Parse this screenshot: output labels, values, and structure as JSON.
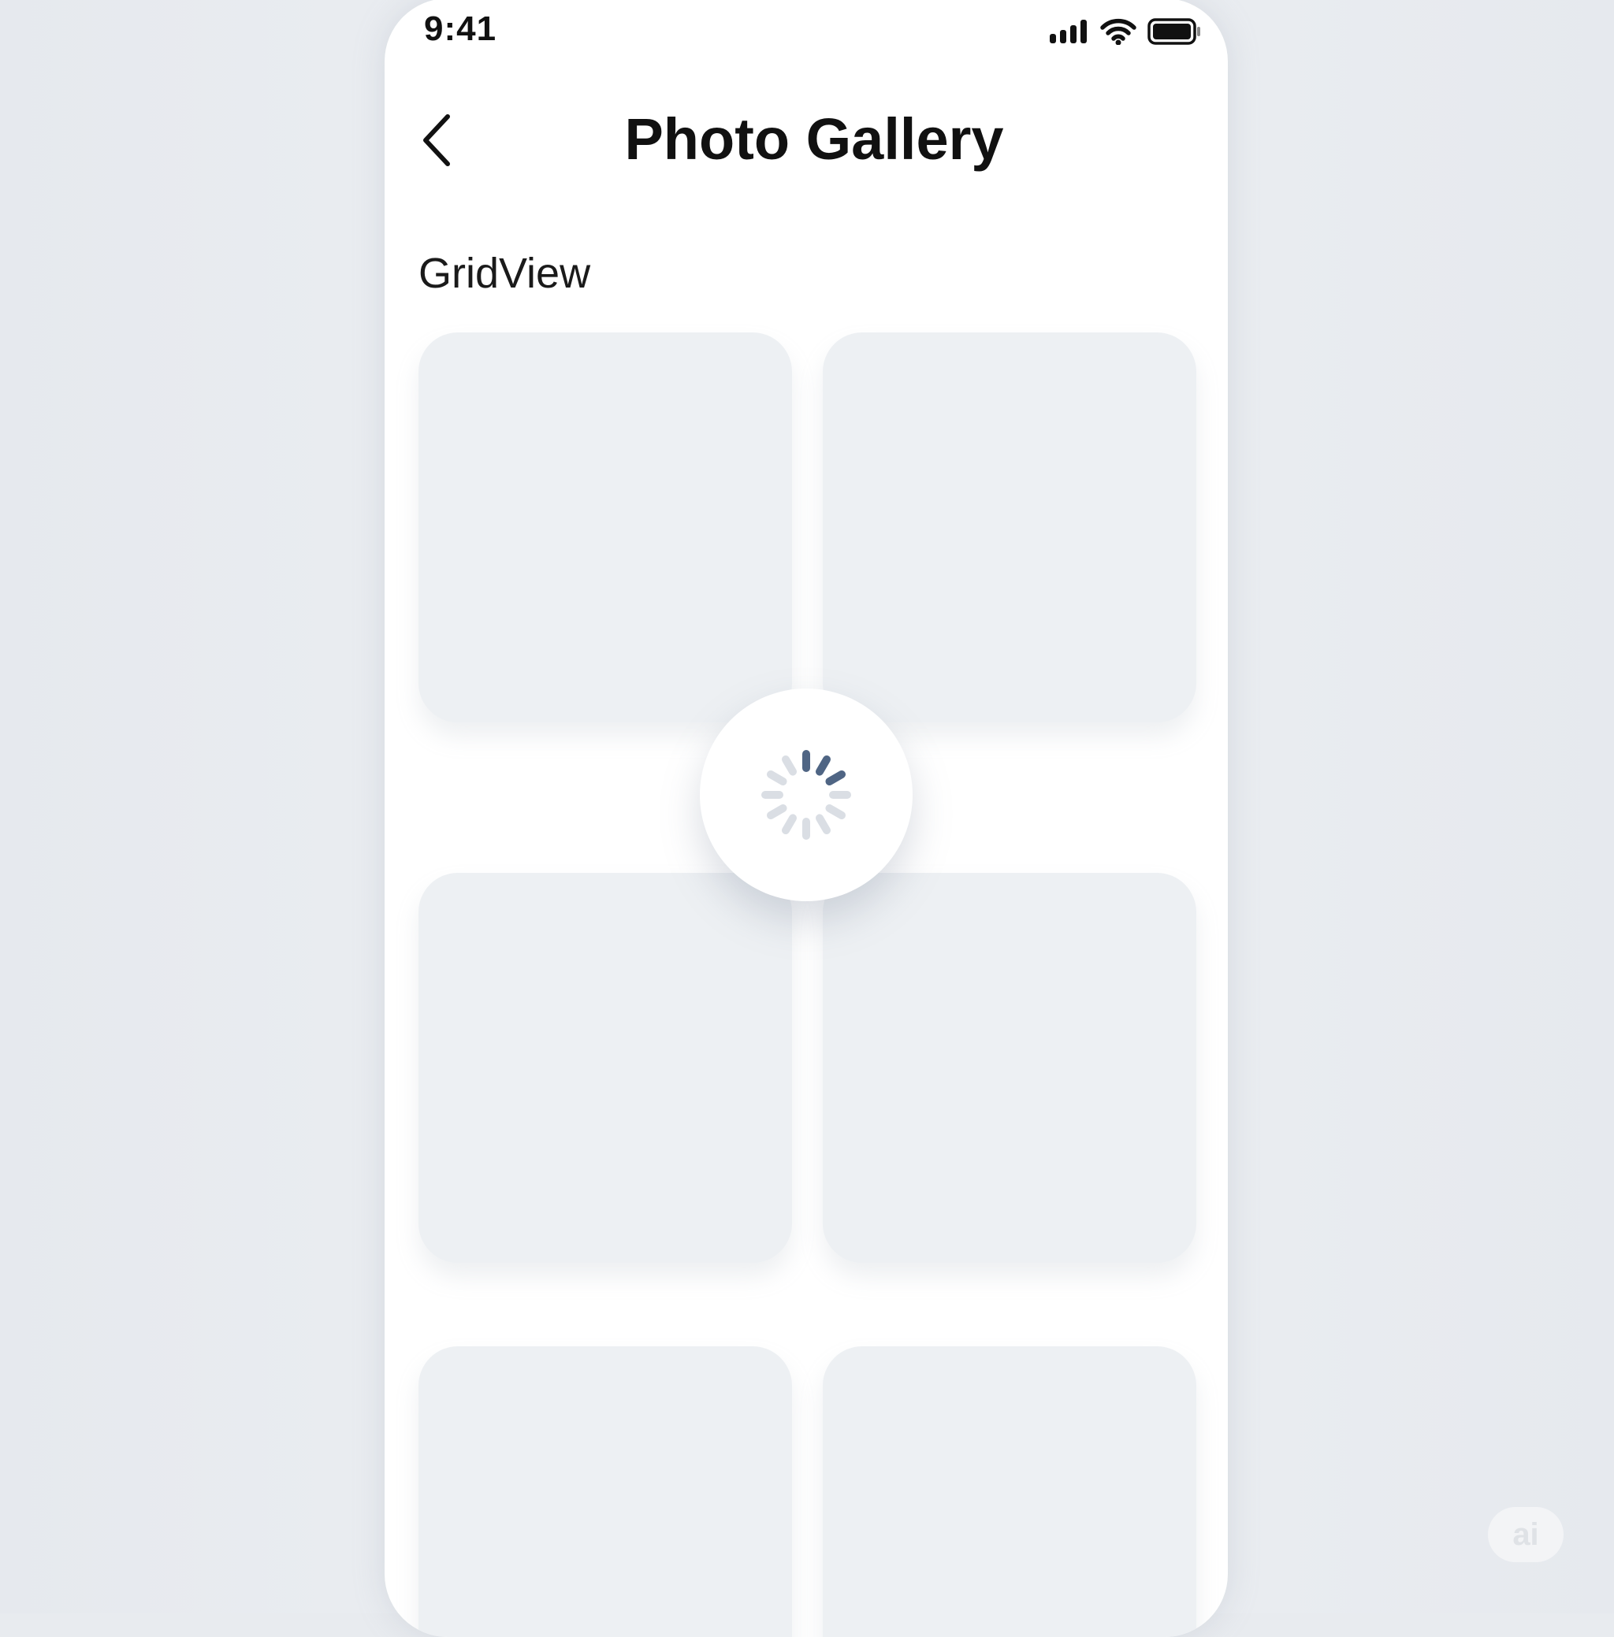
{
  "status_bar": {
    "time": "9:41",
    "signal_icon": "cellular-signal-icon",
    "wifi_icon": "wifi-icon",
    "battery_icon": "battery-icon"
  },
  "nav": {
    "back_icon": "chevron-left-icon",
    "title": "Photo Gallery"
  },
  "section": {
    "label": "GridView"
  },
  "grid": {
    "tiles": [
      "",
      "",
      "",
      "",
      "",
      ""
    ]
  },
  "loader": {
    "icon": "spinner-icon",
    "active_color": "#4f6584",
    "inactive_color": "#d6dbe2"
  },
  "watermark": {
    "label": "ai"
  },
  "colors": {
    "background": "#e8ebef",
    "tile": "#edf0f3",
    "text": "#111111"
  }
}
